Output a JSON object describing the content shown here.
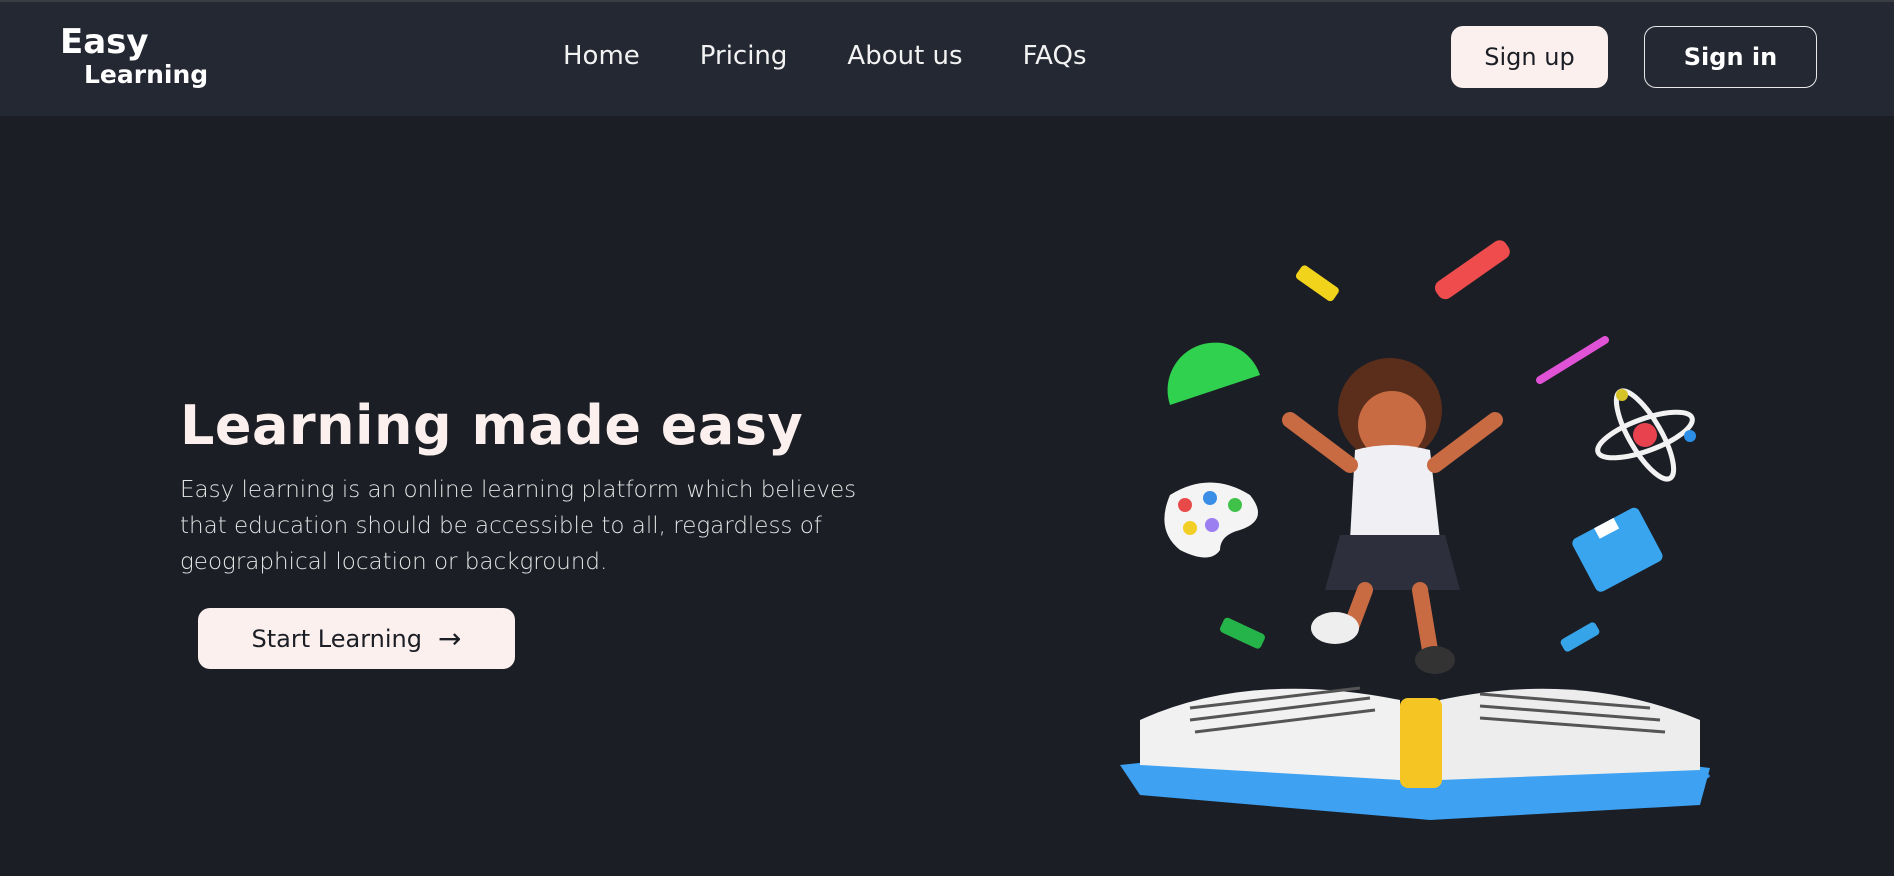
{
  "brand": {
    "line1": "Easy",
    "line2": "Learning"
  },
  "nav": {
    "items": [
      {
        "label": "Home"
      },
      {
        "label": "Pricing"
      },
      {
        "label": "About us"
      },
      {
        "label": "FAQs"
      }
    ]
  },
  "auth": {
    "signup_label": "Sign up",
    "signin_label": "Sign in"
  },
  "hero": {
    "title": "Learning made easy",
    "description": "Easy learning is an online learning platform which believes that education should be accessible to all, regardless of geographical location or background.",
    "cta_label": "Start Learning",
    "cta_icon": "arrow-right-icon"
  },
  "colors": {
    "background": "#1b1e25",
    "header": "#242833",
    "button_light": "#fbf0ee",
    "text": "#fbf0ee"
  }
}
